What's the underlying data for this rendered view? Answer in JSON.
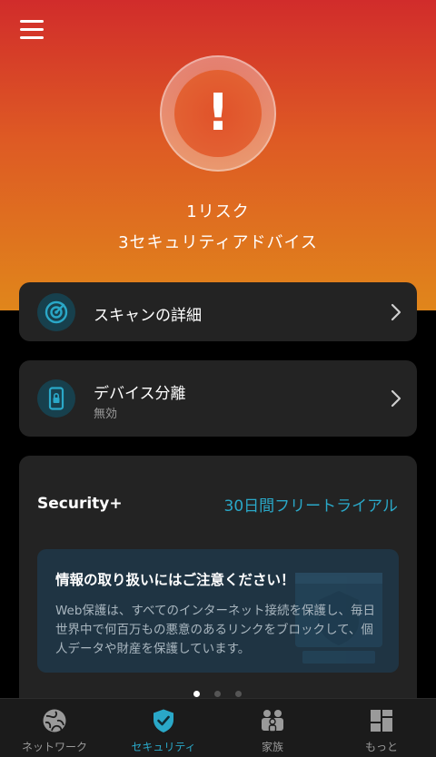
{
  "status": {
    "risk_text": "1リスク",
    "advice_text": "3セキュリティアドバイス",
    "alert_symbol": "!"
  },
  "scan_card": {
    "title": "スキャンの詳細",
    "icon": "radar-icon"
  },
  "isolation_card": {
    "title": "デバイス分離",
    "subtitle": "無効",
    "icon": "device-lock-icon"
  },
  "security_plus": {
    "title": "Security+",
    "trial_label": "30日間フリートライアル",
    "tip": {
      "title": "情報の取り扱いにはご注意ください！",
      "body": "Web保護は、すべてのインターネット接続を保護し、毎日世界中で何百万もの悪意のあるリンクをブロックして、個人データや財産を保護しています。"
    },
    "carousel": {
      "pages": 3,
      "active_page": 1
    }
  },
  "tabs": [
    {
      "label": "ネットワーク",
      "icon": "globe-icon",
      "active": false
    },
    {
      "label": "セキュリティ",
      "icon": "shield-check-icon",
      "active": true
    },
    {
      "label": "家族",
      "icon": "family-icon",
      "active": false
    },
    {
      "label": "もっと",
      "icon": "grid-icon",
      "active": false
    }
  ],
  "colors": {
    "accent": "#2aa8c8",
    "hero_top": "#d12c2b",
    "hero_bottom": "#e0861b",
    "card_bg": "#232323"
  }
}
